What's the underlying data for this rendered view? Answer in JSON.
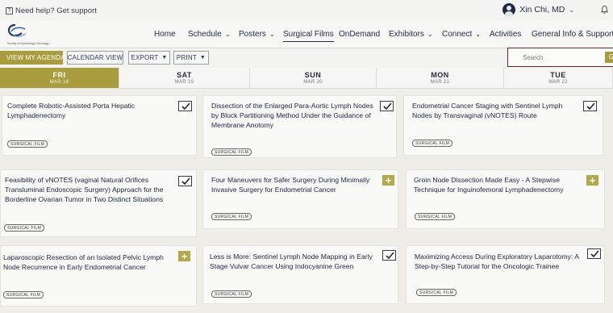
{
  "help": {
    "text": "Need help? Get support",
    "icon": "help-square-icon"
  },
  "user": {
    "name": "Xin Chi, MD"
  },
  "logo": {
    "text": "Society of Gynecologic Oncology"
  },
  "nav": [
    {
      "label": "Home",
      "dropdown": false
    },
    {
      "label": "Schedule",
      "dropdown": true
    },
    {
      "label": "Posters",
      "dropdown": true
    },
    {
      "label": "Surgical Films",
      "dropdown": false,
      "active": true
    },
    {
      "label": "OnDemand",
      "dropdown": false
    },
    {
      "label": "Exhibitors",
      "dropdown": true
    },
    {
      "label": "Connect",
      "dropdown": true
    },
    {
      "label": "Activities",
      "dropdown": false
    },
    {
      "label": "General Info & Support",
      "dropdown": true
    }
  ],
  "toolbar": {
    "agenda": "VIEW MY AGENDA",
    "calendar": "CALENDAR VIEW",
    "export": "EXPORT",
    "print": "PRINT"
  },
  "search": {
    "placeholder": "Search",
    "go": "G"
  },
  "days": [
    {
      "name": "FRI",
      "date": "MAR 18",
      "active": true
    },
    {
      "name": "SAT",
      "date": "MAR 19"
    },
    {
      "name": "SUN",
      "date": "MAR 20"
    },
    {
      "name": "MON",
      "date": "MAR 21"
    },
    {
      "name": "TUE",
      "date": "MAR 22"
    }
  ],
  "tag_label": "SURGICAL FILM",
  "cards": [
    {
      "title": "Complete Robotic-Assisted Porta Hepatic Lymphadenectomy",
      "state": "check"
    },
    {
      "title": "Dissection of the Enlarged Para-Aortic Lymph Nodes by Block Partitioning Method Under the Guidance of Membrane Anotomy",
      "state": "check"
    },
    {
      "title": "Endometrial Cancer Staging with Sentinel Lymph Nodes by Transvaginal (vNOTES) Route",
      "state": "check"
    },
    {
      "title": "Feasibility of vNOTES (vaginal Natural Orifices Transluminal Endoscopic Surgery) Approach for the Borderline Ovarian Tumor in Two Distinct Situations",
      "state": "check"
    },
    {
      "title": "Four Maneuvers for Safer Surgery During Minimally Invasive Surgery for Endometrial Cancer",
      "state": "add"
    },
    {
      "title": "Groin Node Dissection Made Easy - A Stepwise Technique for Inguinofemoral Lymphadenectomy",
      "state": "add"
    },
    {
      "title": "Laparoscopic Resection of an Isolated Pelvic Lymph Node Recurrence in Early Endometrial Cancer",
      "state": "add"
    },
    {
      "title": "Less is More: Sentinel Lymph Node Mapping in Early Stage Vulvar Cancer Using Indocyanine Green",
      "state": "check"
    },
    {
      "title": "Maximizing Access During Exploratory Laparotomy: A Step-by-Step Tutorial for the Oncologic Trainee",
      "state": "check"
    }
  ],
  "colors": {
    "accent": "#a99c3f",
    "navy": "#1e2a44",
    "search_border": "#6a2030"
  }
}
